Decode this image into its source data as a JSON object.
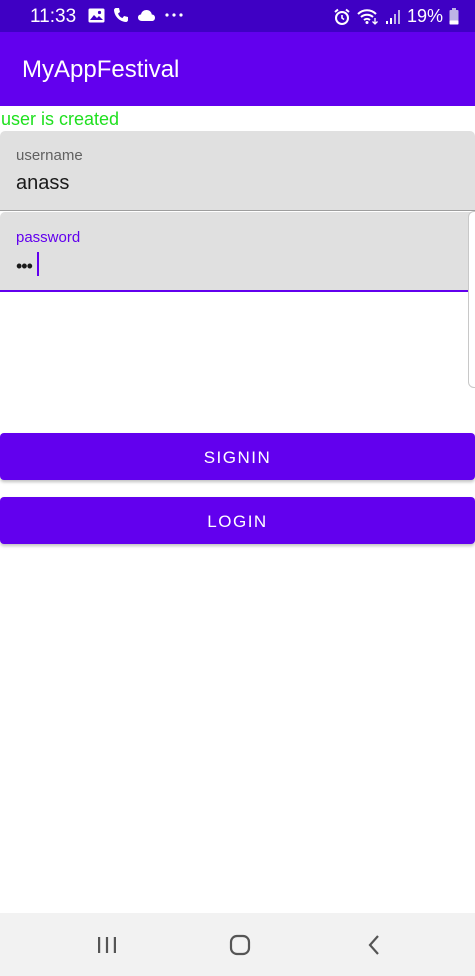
{
  "status_bar": {
    "time": "11:33",
    "battery_percent": "19%",
    "left_icons": [
      "image-icon",
      "phone-icon",
      "cloud-icon",
      "more-dots-icon"
    ],
    "right_icons": [
      "alarm-icon",
      "wifi-icon",
      "signal-icon",
      "battery-icon"
    ]
  },
  "app_bar": {
    "title": "MyAppFestival"
  },
  "status_message": "user is created",
  "form": {
    "username": {
      "label": "username",
      "value": "anass"
    },
    "password": {
      "label": "password",
      "masked_value": "•••"
    }
  },
  "buttons": {
    "signin_label": "SIGNIN",
    "login_label": "LOGIN"
  },
  "nav_bar": {
    "icons": [
      "recent-apps-icon",
      "home-icon",
      "back-icon"
    ]
  },
  "colors": {
    "status_bar": "#3f00c4",
    "primary": "#6200ee",
    "success_text": "#1fe01f",
    "field_background": "#e0e0e0"
  }
}
